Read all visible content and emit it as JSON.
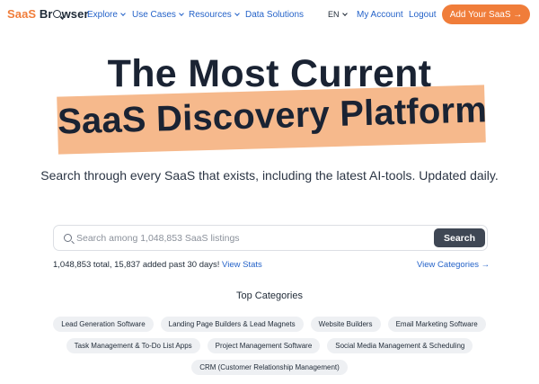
{
  "nav": {
    "logo_prefix": "SaaS",
    "logo_suffix_a": "Br",
    "logo_suffix_b": "wser",
    "links": [
      {
        "label": "Explore",
        "has_dropdown": true
      },
      {
        "label": "Use Cases",
        "has_dropdown": true
      },
      {
        "label": "Resources",
        "has_dropdown": true
      },
      {
        "label": "Data Solutions",
        "has_dropdown": false
      }
    ],
    "language": "EN",
    "account": "My Account",
    "logout": "Logout",
    "cta": "Add Your SaaS →",
    "accent_color": "#f07d3a",
    "link_color": "#2563c9"
  },
  "hero": {
    "title_line1": "The Most Current",
    "title_line2": "SaaS Discovery Platform",
    "subtitle": "Search through every SaaS that exists, including the latest AI-tools. Updated daily.",
    "highlight_color": "#f6b98c"
  },
  "search": {
    "placeholder": "Search among 1,048,853 SaaS listings",
    "value": "",
    "button": "Search"
  },
  "stats": {
    "text": "1,048,853 total, 15,837 added past 30 days!",
    "view_stats": "View Stats",
    "view_categories": "View Categories →"
  },
  "categories": {
    "title": "Top Categories",
    "rows": [
      [
        "Lead Generation Software",
        "Landing Page Builders & Lead Magnets",
        "Website Builders",
        "Email Marketing Software"
      ],
      [
        "Task Management & To-Do List Apps",
        "Project Management Software",
        "Social Media Management & Scheduling"
      ],
      [
        "CRM (Customer Relationship Management)"
      ]
    ]
  }
}
